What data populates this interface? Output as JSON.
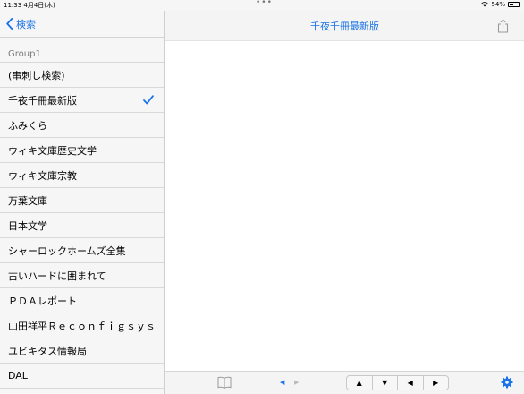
{
  "status": {
    "time_date": "11:33  4月4日(木)",
    "battery": "54%",
    "battery_level": 0.54
  },
  "sidebar": {
    "back_label": "検索",
    "section": "Group1",
    "items": [
      {
        "label": "(串刺し検索)"
      },
      {
        "label": "千夜千冊最新版",
        "selected": true
      },
      {
        "label": "ふみくら"
      },
      {
        "label": "ウィキ文庫歴史文学"
      },
      {
        "label": "ウィキ文庫宗教"
      },
      {
        "label": "万葉文庫"
      },
      {
        "label": "日本文学"
      },
      {
        "label": "シャーロックホームズ全集"
      },
      {
        "label": "古いハードに囲まれて"
      },
      {
        "label": "ＰＤＡレポート"
      },
      {
        "label": "山田祥平Ｒｅｃｏｎｆｉｇｓｙｓ"
      },
      {
        "label": "ユビキタス情報局"
      },
      {
        "label": "DAL"
      }
    ]
  },
  "main": {
    "title": "千夜千冊最新版"
  },
  "toolbar": {
    "prev_small": "◀",
    "next_small": "▶",
    "nav_buttons": [
      "▲",
      "▼",
      "◀",
      "▶"
    ]
  },
  "colors": {
    "accent": "#1b73e8"
  }
}
